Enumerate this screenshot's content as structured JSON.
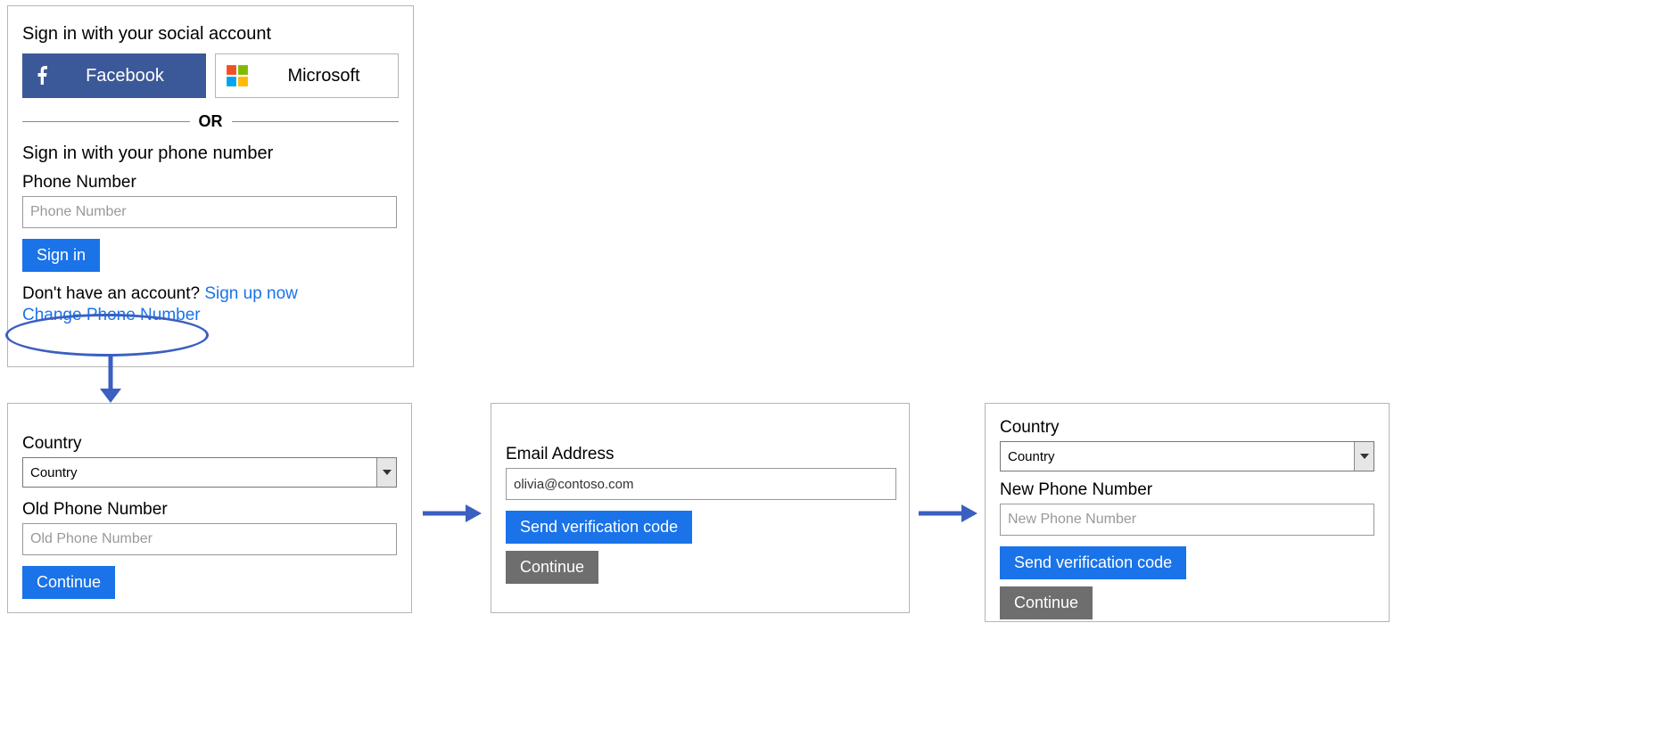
{
  "signin_panel": {
    "social_heading": "Sign in with your social account",
    "facebook_label": "Facebook",
    "microsoft_label": "Microsoft",
    "divider_or": "OR",
    "phone_heading": "Sign in with your phone number",
    "phone_label": "Phone Number",
    "phone_placeholder": "Phone Number",
    "signin_btn": "Sign in",
    "no_account_text": "Don't have an account? ",
    "signup_link": "Sign up now",
    "change_phone_link": "Change Phone Number"
  },
  "step1": {
    "country_label": "Country",
    "country_value": "Country",
    "old_phone_label": "Old Phone Number",
    "old_phone_placeholder": "Old Phone Number",
    "continue_btn": "Continue"
  },
  "step2": {
    "email_label": "Email Address",
    "email_value": "olivia@contoso.com",
    "send_code_btn": "Send verification code",
    "continue_btn": "Continue"
  },
  "step3": {
    "country_label": "Country",
    "country_value": "Country",
    "new_phone_label": "New Phone Number",
    "new_phone_placeholder": "New Phone Number",
    "send_code_btn": "Send verification code",
    "continue_btn": "Continue"
  }
}
